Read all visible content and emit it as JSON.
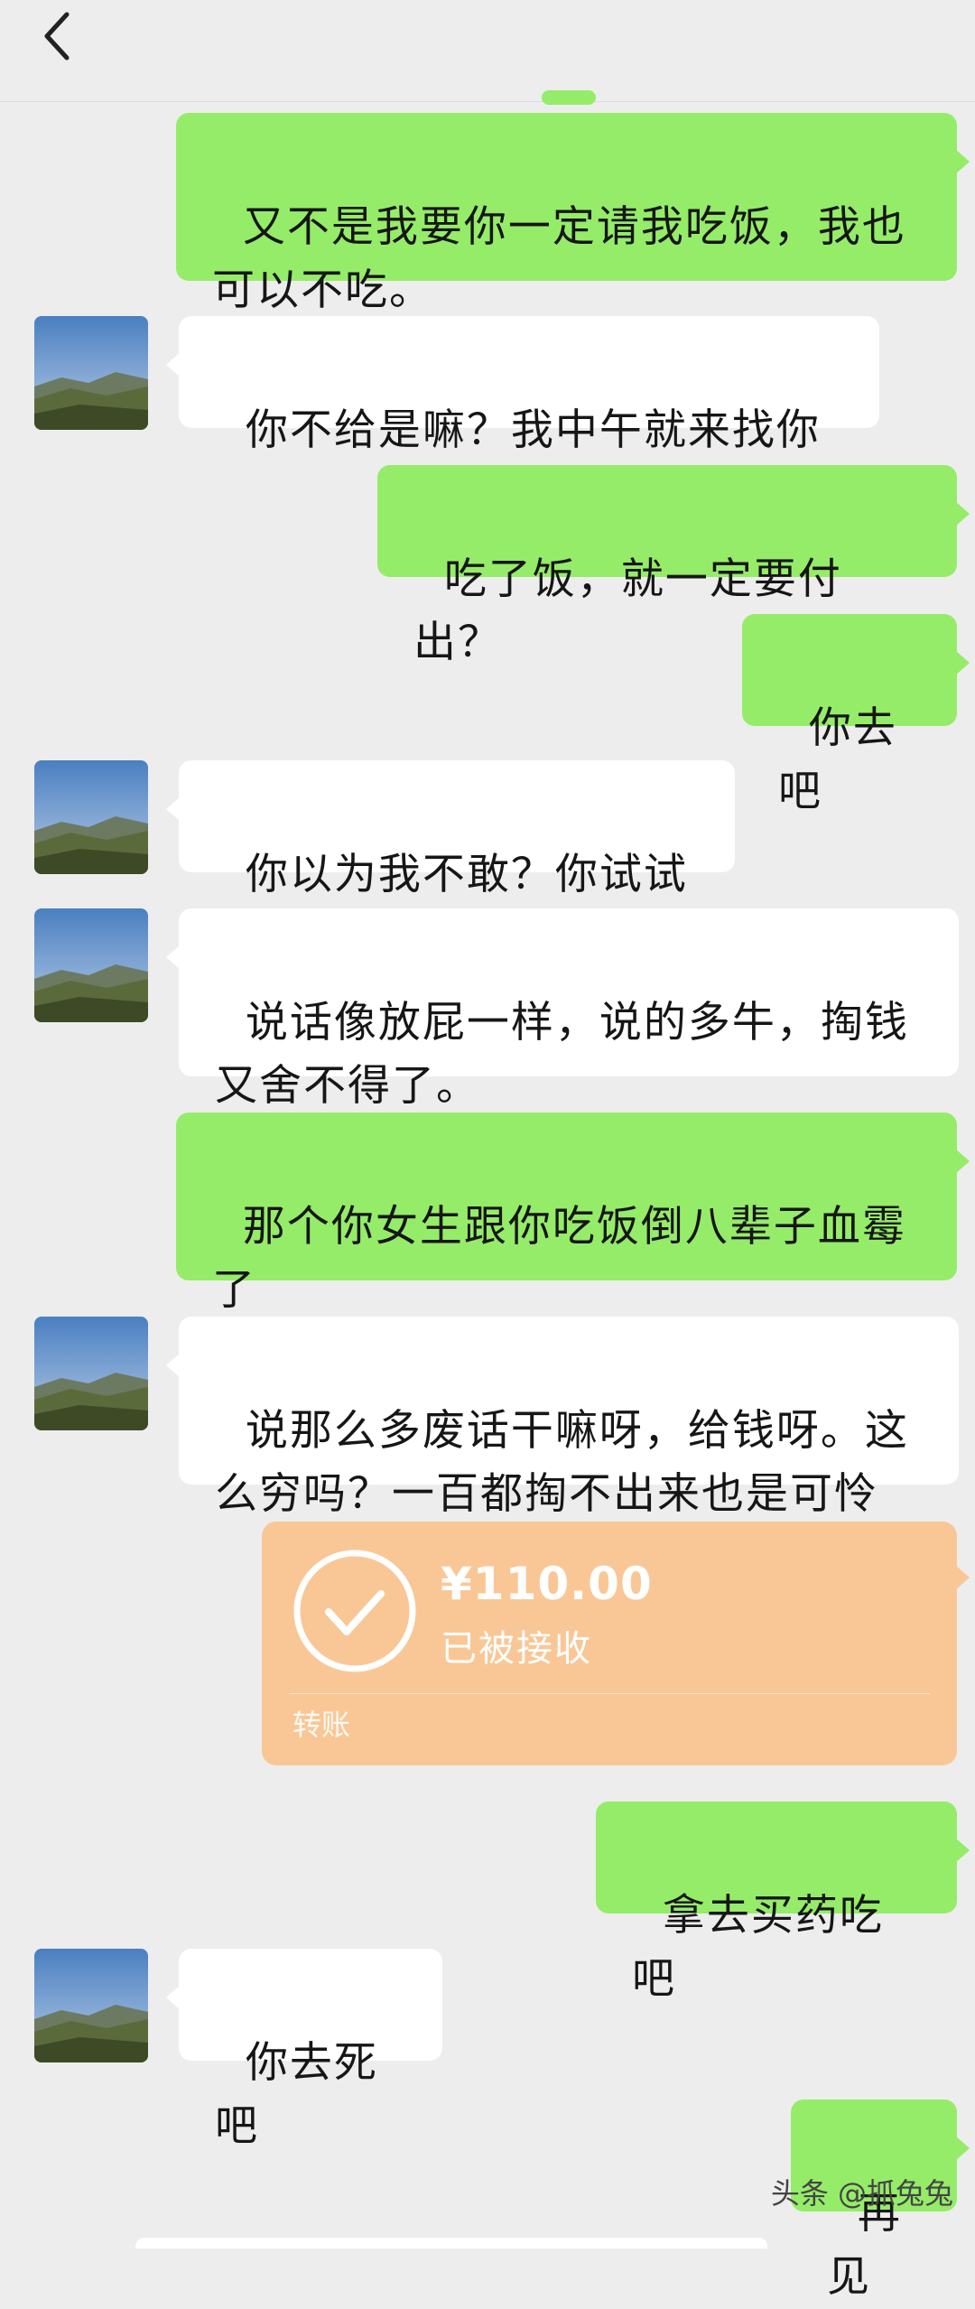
{
  "header": {
    "back_icon": "chevron-left-icon"
  },
  "messages": [
    {
      "side": "me",
      "text": "又不是我要你一定请我吃饭，我也\n可以不吃。"
    },
    {
      "side": "them",
      "text": "你不给是嘛？我中午就来找你"
    },
    {
      "side": "me",
      "text": "吃了饭，就一定要付出？"
    },
    {
      "side": "me",
      "text": "你去吧"
    },
    {
      "side": "them",
      "text": "你以为我不敢？你试试"
    },
    {
      "side": "them",
      "text": "说话像放屁一样，说的多牛，掏钱\n又舍不得了。"
    },
    {
      "side": "me",
      "text": "那个你女生跟你吃饭倒八辈子血霉\n了"
    },
    {
      "side": "them",
      "text": "说那么多废话干嘛呀，给钱呀。这\n么穷吗？一百都掏不出来也是可怜"
    },
    {
      "side": "me",
      "text": "拿去买药吃吧"
    },
    {
      "side": "them",
      "text": "你去死吧"
    },
    {
      "side": "me",
      "text": "再见"
    }
  ],
  "transfer": {
    "amount": "¥110.00",
    "status": "已被接收",
    "label": "转账",
    "icon": "check-circle-icon",
    "color": "#f9c796"
  },
  "watermark": "头条 @抓兔兔",
  "colors": {
    "background": "#ededed",
    "my_bubble": "#95ec69",
    "their_bubble": "#ffffff"
  }
}
